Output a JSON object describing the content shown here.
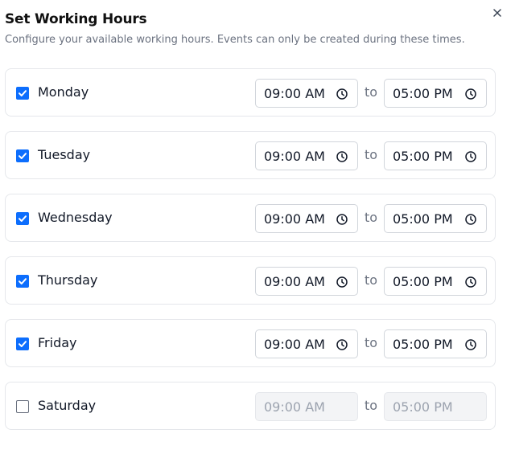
{
  "dialog": {
    "title": "Set Working Hours",
    "description": "Configure your available working hours. Events can only be created during these times.",
    "close_label": "×"
  },
  "separator": "to",
  "days": [
    {
      "label": "Monday",
      "enabled": true,
      "start": "09:00 AM",
      "end": "05:00 PM"
    },
    {
      "label": "Tuesday",
      "enabled": true,
      "start": "09:00 AM",
      "end": "05:00 PM"
    },
    {
      "label": "Wednesday",
      "enabled": true,
      "start": "09:00 AM",
      "end": "05:00 PM"
    },
    {
      "label": "Thursday",
      "enabled": true,
      "start": "09:00 AM",
      "end": "05:00 PM"
    },
    {
      "label": "Friday",
      "enabled": true,
      "start": "09:00 AM",
      "end": "05:00 PM"
    },
    {
      "label": "Saturday",
      "enabled": false,
      "start": "09:00 AM",
      "end": "05:00 PM"
    }
  ],
  "icons": {
    "close": "close-icon",
    "time": "clock-icon",
    "check": "checkmark-icon"
  },
  "colors": {
    "accent": "#0d6efd",
    "muted_text": "#6b7280",
    "disabled_bg": "#f3f4f6"
  }
}
